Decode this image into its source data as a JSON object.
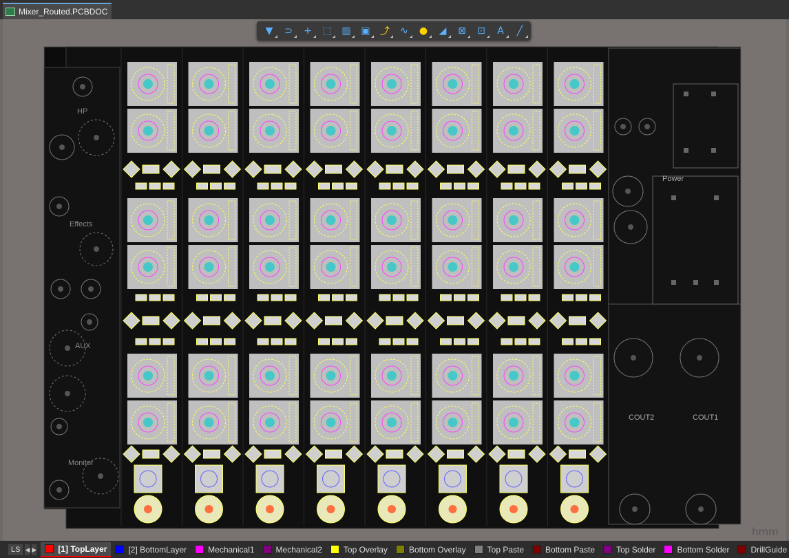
{
  "document": {
    "tab_title": "Mixer_Routed.PCBDOC"
  },
  "toolbar": {
    "tools": [
      {
        "name": "filter-icon",
        "glyph": "▼",
        "color": "blue"
      },
      {
        "name": "route-icon",
        "glyph": "⊃",
        "color": "blue"
      },
      {
        "name": "crosshair-icon",
        "glyph": "+",
        "color": "blue"
      },
      {
        "name": "select-rect-icon",
        "glyph": "⬚",
        "color": "blue"
      },
      {
        "name": "align-icon",
        "glyph": "▥",
        "color": "blue"
      },
      {
        "name": "component-icon",
        "glyph": "▣",
        "color": "blue"
      },
      {
        "name": "interactive-route-icon",
        "glyph": "⤴",
        "color": "yellow"
      },
      {
        "name": "diff-pair-icon",
        "glyph": "∿",
        "color": "blue"
      },
      {
        "name": "via-icon",
        "glyph": "●",
        "color": "yellow"
      },
      {
        "name": "polygon-icon",
        "glyph": "◢",
        "color": "blue"
      },
      {
        "name": "region-icon",
        "glyph": "⊠",
        "color": "blue"
      },
      {
        "name": "dimension-icon",
        "glyph": "⊡",
        "color": "blue"
      },
      {
        "name": "text-icon",
        "glyph": "A",
        "color": "blue"
      },
      {
        "name": "line-icon",
        "glyph": "╱",
        "color": "blue"
      }
    ]
  },
  "board": {
    "labels": {
      "hp": "HP",
      "effects": "Effects",
      "aux": "AUX",
      "monitor": "Monitor",
      "power": "Power",
      "cout2": "COUT2",
      "cout1": "COUT1"
    }
  },
  "canvas": {
    "corner_text": "hmm"
  },
  "status": {
    "ls_label": "LS",
    "layers": [
      {
        "label": "[1] TopLayer",
        "color": "#ff0000",
        "active": true
      },
      {
        "label": "[2] BottomLayer",
        "color": "#0000ff",
        "active": false
      },
      {
        "label": "Mechanical1",
        "color": "#ff00ff",
        "active": false
      },
      {
        "label": "Mechanical2",
        "color": "#800080",
        "active": false
      },
      {
        "label": "Top Overlay",
        "color": "#ffff00",
        "active": false
      },
      {
        "label": "Bottom Overlay",
        "color": "#808000",
        "active": false
      },
      {
        "label": "Top Paste",
        "color": "#808080",
        "active": false
      },
      {
        "label": "Bottom Paste",
        "color": "#800000",
        "active": false
      },
      {
        "label": "Top Solder",
        "color": "#800080",
        "active": false
      },
      {
        "label": "Bottom Solder",
        "color": "#ff00ff",
        "active": false
      },
      {
        "label": "DrillGuide",
        "color": "#800000",
        "active": false
      }
    ]
  }
}
